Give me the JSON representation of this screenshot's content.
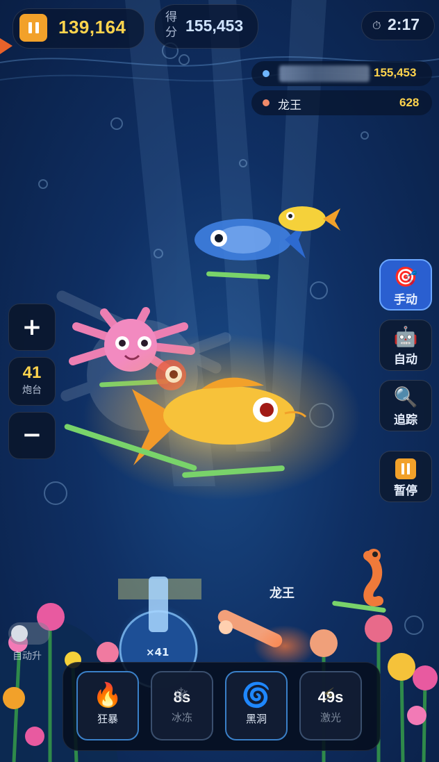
{
  "top_bar": {
    "coins": "139,164",
    "score_label": "得分",
    "score": "155,453",
    "timer_icon": "⏱",
    "timer": "2:17"
  },
  "leaderboard": [
    {
      "name": "6054",
      "score": "155,453",
      "color": "#6fb6ff"
    },
    {
      "name": "龙王",
      "score": "628",
      "color": "#f08a6a"
    }
  ],
  "side_buttons": {
    "manual": {
      "icon": "🎯",
      "label": "手动"
    },
    "auto": {
      "icon": "🤖",
      "label": "自动"
    },
    "track": {
      "icon": "🔍",
      "label": "追踪"
    },
    "pause": {
      "icon": "pause-icon",
      "label": "暂停"
    }
  },
  "cannon": {
    "plus": "+",
    "level": "41",
    "label": "炮台",
    "minus": "−",
    "multiplier": "×41"
  },
  "scene": {
    "player_tag": "龙王",
    "auto_label": "自动升"
  },
  "skills": [
    {
      "icon": "🔥",
      "cooldown": "",
      "label": "狂暴"
    },
    {
      "icon": "❄",
      "cooldown": "8s",
      "label": "冰冻"
    },
    {
      "icon": "🌀",
      "cooldown": "",
      "label": "黑洞"
    },
    {
      "icon": "⚡",
      "cooldown": "49s",
      "label": "激光"
    }
  ],
  "colors": {
    "accent_gold": "#ffd44d",
    "active_button": "#2a5fd0",
    "pause_orange": "#f2a12a"
  }
}
